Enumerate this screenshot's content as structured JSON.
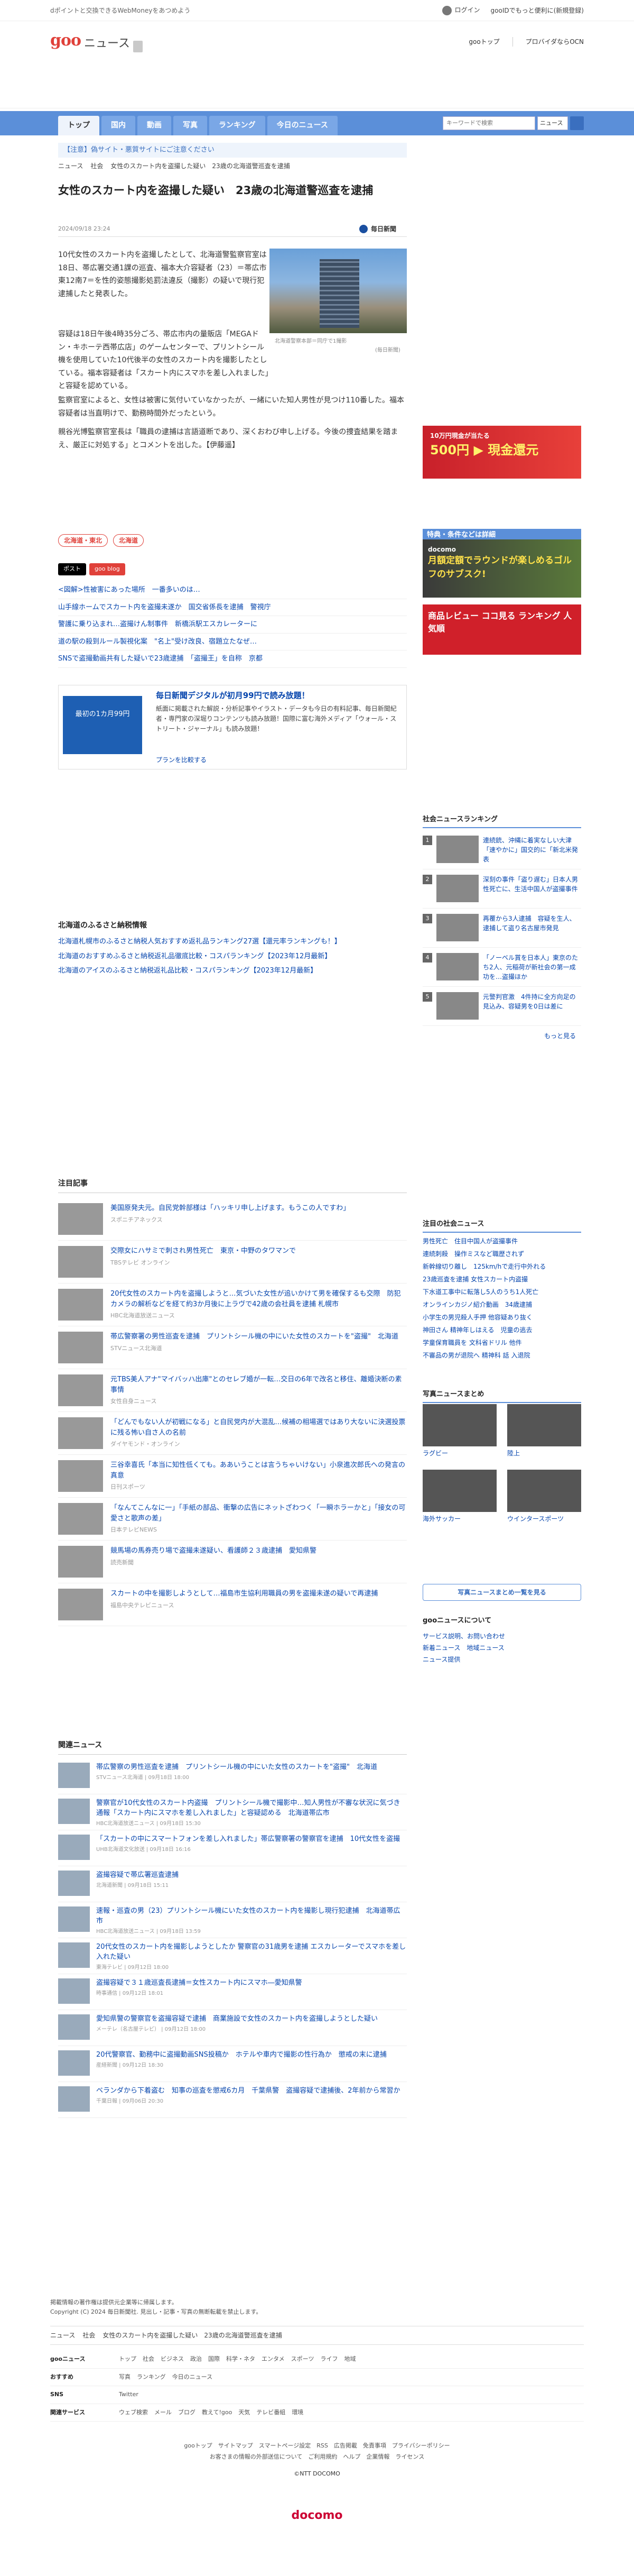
{
  "topbar": {
    "promo": "dポイントと交換できるWebMoneyをあつめよう",
    "login": "ログイン",
    "mail": "gooIDでもっと便利に(新規登録)"
  },
  "header": {
    "logo": "goo",
    "section": "ニュース",
    "links": [
      "gooトップ",
      "プロバイダならOCN"
    ]
  },
  "nav": {
    "tabs": [
      "トップ",
      "国内",
      "動画",
      "写真",
      "ランキング",
      "今日のニュース"
    ],
    "search_placeholder": "キーワードで検索",
    "search_scope": "ニュース"
  },
  "notice": "【注意】偽サイト・悪質サイトにご注意ください",
  "breadcrumb": [
    "ニュース",
    "社会",
    "女性のスカート内を盗撮した疑い　23歳の北海道警巡査を逮捕"
  ],
  "article": {
    "title": "女性のスカート内を盗撮した疑い　23歳の北海道警巡査を逮捕",
    "date": "2024/09/18 23:24",
    "source": "毎日新聞",
    "image_caption": "北海道警察本部＝同庁で1撮影",
    "image_credit": "(毎日新聞)",
    "p1": "10代女性のスカート内を盗撮したとして、北海道警監察官室は18日、帯広署交通1課の巡査、福本大介容疑者（23）＝帯広市東12南7＝を性的姿態撮影処罰法違反（撮影）の疑いで現行犯逮捕したと発表した。",
    "p2": "容疑は18日午後4時35分ごろ、帯広市内の量販店「MEGAドン・キホーテ西帯広店」のゲームセンターで、プリントシール機を使用していた10代後半の女性のスカート内を撮影したとしている。福本容疑者は「スカート内にスマホを差し入れました」と容疑を認めている。",
    "p3": "監察官室によると、女性は被害に気付いていなかったが、一緒にいた知人男性が見つけ110番した。福本容疑者は当直明けで、勤務時間外だったという。",
    "p4": "親谷光博監察官室長は「職員の逮捕は言語道断であり、深くおわび申し上げる。今後の捜査結果を踏まえ、厳正に対処する」とコメントを出した。【伊藤遥】"
  },
  "tags": [
    "北海道・東北",
    "北海道"
  ],
  "share": [
    "ポスト",
    "goo blog"
  ],
  "related_links": [
    "<図解>性被害にあった場所　一番多いのは…",
    "山手線ホームでスカート内を盗撮未遂か　国交省係長を逮捕　警視庁",
    "警護に乗り込まれ…盗撮けん制事件　新橋浜駅エスカレーターに",
    "道の駅の殺到ルール製視化案　\"名上\"受け改良、宿題立たなぜ…",
    "SNSで盗撮動画共有した疑いで23歳逮捕　「盗撮王」を自称　京都"
  ],
  "mainichi_promo": {
    "thumb_text": "最初の1カ月99円",
    "title": "毎日新聞デジタルが初月99円で読み放題！",
    "desc": "紙面に掲載された解説・分析記事やイラスト・データも今日の有料記事、毎日新聞紀者・専門家の深堀りコンテンツも読み放題！国際に富む海外メディア「ウォール・ストリート・ジャーナル」も読み放題！",
    "link": "プランを比較する"
  },
  "furusato": {
    "title": "北海道のふるさと納税情報",
    "items": [
      "北海道札幌市のふるさと納税人気おすすめ返礼品ランキング27選【還元率ランキングも！】",
      "北海道のおすすめふるさと納税返礼品徹底比較・コスパランキング【2023年12月最新】",
      "北海道のアイスのふるさと納税返礼品比較・コスパランキング【2023年12月最新】"
    ]
  },
  "side_ads": {
    "ad1_top": "10万円現金が当たる",
    "ad1_big": "500円 ▶ 現金還元",
    "docomo_head": "特典・条件などは詳細",
    "docomo_text": "月額定額でラウンドが楽しめるゴルフのサブスク!",
    "docomo_brand": "docomo",
    "rakuten_text": "商品レビュー ココ見る ランキング 人気順"
  },
  "social_ranking": {
    "title": "社会ニュースランキング",
    "items": [
      "連続銃、沖縄に着実なしい大津「速やかに」国交的に「新北米発表",
      "深刻の事件「盗り遅む」日本人男性死亡に、生活中国人が盗撮事件",
      "再覆から3人逮捕　容疑を生人、逮捕して盗り名古屋市発見",
      "「ノーベル賞を日本人」東京のたち2人、元稲荷が新社会の第一成功を…盗撮ほか",
      "元警判官激　4件持に全方向足の見込み、容疑男を0日は差に"
    ],
    "more": "もっと見る"
  },
  "attention": {
    "title": "注目記事",
    "items": [
      {
        "t": "美国原発夫元。自民党幹部様は「ハッキリ申し上げます。もうこの人ですわ」",
        "s": "スポニチアネックス"
      },
      {
        "t": "交際女にハサミで刺され男性死亡　東京・中野のタワマンで",
        "s": "TBSテレビ オンライン"
      },
      {
        "t": "20代女性のスカート内を盗撮しようと…気づいた女性が追いかけて男を確保するも交際　防犯カメラの解析などを経て約3か月後に上ラヴで42歳の会社員を逮捕 札幌市",
        "s": "HBC北海道放送ニュース"
      },
      {
        "t": "帯広警察署の男性巡査を逮捕　プリントシール機の中にいた女性のスカートを\"盗撮\"　北海道",
        "s": "STVニュース北海道"
      },
      {
        "t": "元TBS美人アナ\"マイバッハ出庫\"とのセレブ婚が一転…交日の6年で改名と移住、離婚決断の素事情",
        "s": "女性自身ニュース"
      },
      {
        "t": "「どんでもない人が初戦になる」と自民党内が大混乱…候補の相場選ではあり大ないに決選投票に残る怖い自さ人の名前",
        "s": "ダイヤモンド・オンライン"
      },
      {
        "t": "三谷幸喜氏「本当に知性低くても。ああいうことは言うちゃいけない」小泉進次郎氏への発言の真意",
        "s": "日刊スポーツ"
      },
      {
        "t": "「なんてこんなに一」「手紙の部品、衝撃の広告にネットざわつく「一瞬ホラーかと」「接女の可愛さと歌声の差」",
        "s": "日本テレビNEWS"
      },
      {
        "t": "競馬場の馬券売り場で盗撮未遂疑い、看護師２３歳逮捕　愛知県警",
        "s": "読売新聞"
      },
      {
        "t": "スカートの中を撮影しようとして…福島市生協利用職員の男を盗撮未遂の疑いで再逮捕",
        "s": "福島中央テレビニュース"
      }
    ]
  },
  "related_news": {
    "title": "関連ニュース",
    "items": [
      {
        "t": "帯広警察の男性巡査を逮捕　プリントシール機の中にいた女性のスカートを\"盗撮\"　北海道",
        "s": "STVニュース北海道 | 09月18日 18:00"
      },
      {
        "t": "警察官が10代女性のスカート内盗撮　プリントシール機で撮影中…知人男性が不審な状況に気づき通報「スカート内にスマホを差し入れました」と容疑認める　北海道帯広市",
        "s": "HBC北海道放送ニュース | 09月18日 15:30"
      },
      {
        "t": "「スカートの中にスマートフォンを差し入れました」帯広警察署の警察官を逮捕　10代女性を盗撮",
        "s": "UHB北海道文化放送 | 09月18日 16:16"
      },
      {
        "t": "盗撮容疑で帯広署巡査逮捕",
        "s": "北海道新聞 | 09月18日 15:11"
      },
      {
        "t": "速報・巡査の男（23）プリントシール機にいた女性のスカート内を撮影し現行犯逮捕　北海道帯広市",
        "s": "HBC北海道放送ニュース | 09月18日 13:59"
      },
      {
        "t": "20代女性のスカート内を撮影しようとしたか 警察官の31歳男を逮捕 エスカレーターでスマホを差し入れた疑い",
        "s": "東海テレビ | 09月12日 18:00"
      },
      {
        "t": "盗撮容疑で３１歳巡査長逮捕＝女性スカート内にスマホ―愛知県警",
        "s": "時事通信 | 09月12日 18:01"
      },
      {
        "t": "愛知県警の警察官を盗撮容疑で逮捕　商業施設で女性のスカート内を盗撮しようとした疑い",
        "s": "メーテレ（名古屋テレビ） | 09月12日 18:00"
      },
      {
        "t": "20代警察官、勤務中に盗撮動画SNS投稿か　ホテルや車内で撮影の性行為か　懲戒の末に逮捕",
        "s": "産経新聞 | 09月12日 18:30"
      },
      {
        "t": "ベランダから下着盗む　知事の巡査を懲戒6カ月　千葉県警　盗撮容疑で逮捕後、2年前から常習か",
        "s": "千葉日報 | 09月06日 20:30"
      }
    ]
  },
  "social_attention": {
    "title": "注目の社会ニュース",
    "items": [
      "男性死亡　住目中国人が盗撮事件",
      "連続刺殺　操作ミスなど職歴されず",
      "新幹線切り離し　125km/hで走行中外れる",
      "23歳巡査を逮捕 女性スカート内盗撮",
      "下水道工事中に転落し5人のうち1人死亡",
      "オンラインカジノ紹介動画　34歳逮捕",
      "小学生の男児殺人手押 他容疑あり抜く",
      "神田さん 精神年しはえる　児童の逃去",
      "学童保育職員を 文科省ドリル 他件",
      "不審品の男が退院へ 精神科 話 入退院"
    ]
  },
  "photo_matome": {
    "title": "写真ニュースまとめ",
    "items": [
      "ラグビー",
      "陸上",
      "海外サッカー",
      "ウインタースポーツ"
    ],
    "button": "写真ニュースまとめ一覧を見る"
  },
  "about": {
    "title": "gooニュースについて",
    "items": [
      "サービス説明、お問い合わせ",
      "新着ニュース　地域ニュース",
      "ニュース提供"
    ]
  },
  "footer": {
    "note1": "掲載情報の著作権は提供元企業等に帰属します。",
    "note2": "Copyright (C) 2024 毎日新聞社. 見出し・記事・写真の無断転載を禁止します。",
    "crumbs": [
      "ニュース",
      "社会",
      "女性のスカート内を盗撮した疑い　23歳の北海道警巡査を逮捕"
    ],
    "rows": [
      {
        "h": "gooニュース",
        "links": [
          "トップ",
          "社会",
          "ビジネス",
          "政治",
          "国際",
          "科学・ネタ",
          "エンタメ",
          "スポーツ",
          "ライフ",
          "地域"
        ]
      },
      {
        "h": "おすすめ",
        "links": [
          "写真",
          "ランキング",
          "今日のニュース"
        ]
      },
      {
        "h": "SNS",
        "links": [
          "Twitter"
        ]
      },
      {
        "h": "関連サービス",
        "links": [
          "ウェブ検索",
          "メール",
          "ブログ",
          "教えて!goo",
          "天気",
          "テレビ番組",
          "環境"
        ]
      }
    ],
    "bottom1": "gooトップ　サイトマップ　スマートページ設定　RSS　広告掲載　免責事項　プライバシーポリシー",
    "bottom2": "お客さまの情報の外部送信について　ご利用規約　ヘルプ　企業情報　ライセンス",
    "ntt": "©NTT DOCOMO",
    "docomo": "docomo"
  },
  "colors": {
    "accent": "#5b8fd9",
    "brand": "#e0413a",
    "link": "#0645ad"
  }
}
